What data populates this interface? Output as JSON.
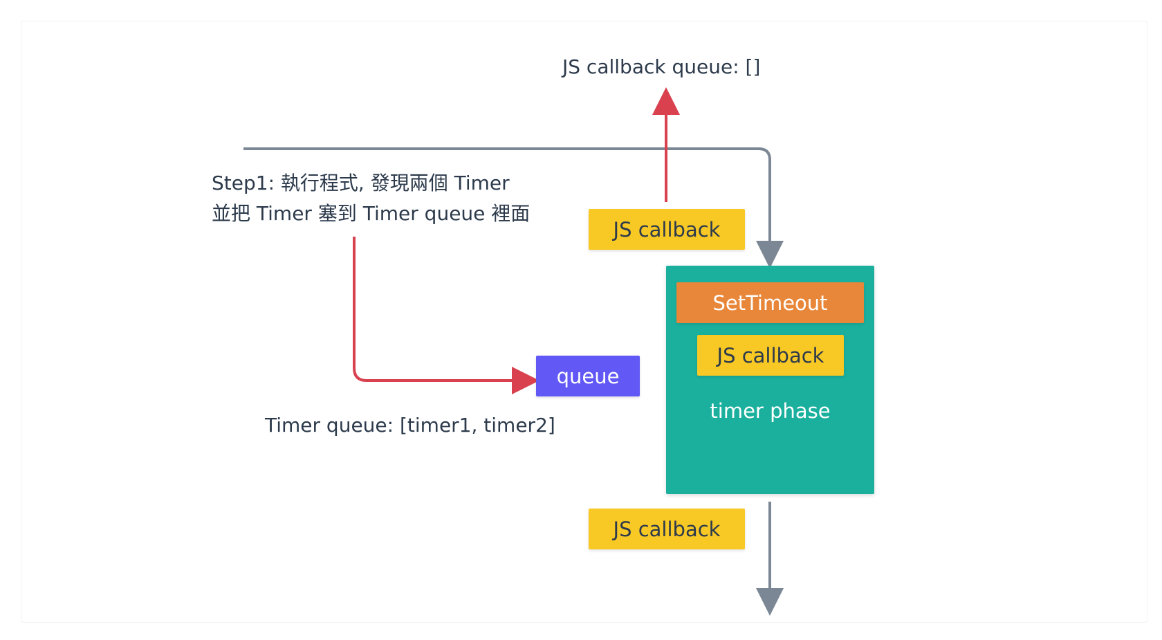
{
  "labels": {
    "js_callback_queue": "JS callback queue: []",
    "step1_line1": "Step1: 執行程式, 發現兩個 Timer",
    "step1_line2": "並把 Timer 塞到 Timer queue 裡面",
    "timer_queue": "Timer queue: [timer1, timer2]"
  },
  "boxes": {
    "js_callback_top": "JS callback",
    "set_timeout": "SetTimeout",
    "js_callback_inner": "JS callback",
    "timer_phase": "timer phase",
    "queue": "queue",
    "js_callback_bottom": "JS callback"
  },
  "colors": {
    "gray_arrow": "#7c8795",
    "red_arrow": "#d9414f",
    "yellow": "#f8c825",
    "orange": "#e8873a",
    "purple": "#6158f5",
    "teal": "#1bb09e",
    "text": "#2c3a4b"
  }
}
